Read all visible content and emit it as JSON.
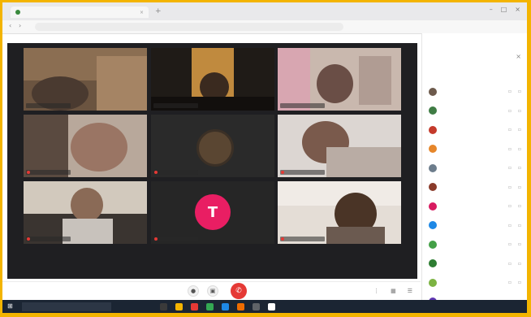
{
  "browser": {
    "tab_title": "",
    "url": "",
    "new_tab_glyph": "+",
    "close_glyph": "×",
    "window_controls": [
      "–",
      "□",
      "×"
    ],
    "back_glyph": "‹",
    "forward_glyph": "›"
  },
  "meeting": {
    "info": "",
    "end_call_glyph": "✆",
    "left_controls": [
      "●",
      "▣"
    ],
    "right_controls": [
      "⋮",
      "▦",
      "☰"
    ]
  },
  "participants_panel": {
    "header": "",
    "close_glyph": "×",
    "sub_left": "",
    "sub_right": "",
    "rows": [
      {
        "color": "#6d5a4c"
      },
      {
        "color": "#3f7c44"
      },
      {
        "color": "#c43a2b"
      },
      {
        "color": "#e6862a"
      },
      {
        "color": "#6d7d8c"
      },
      {
        "color": "#8a3b2a"
      },
      {
        "color": "#d81b60"
      },
      {
        "color": "#1e88e5"
      },
      {
        "color": "#43a047"
      },
      {
        "color": "#2e7d32"
      },
      {
        "color": "#7cb342"
      },
      {
        "color": "#5e35b1"
      }
    ]
  },
  "taskbar": {
    "start_glyph": "⊞",
    "search": "",
    "tray": "",
    "app_icon_colors": [
      "#3a3a3a",
      "#f4b400",
      "#e53935",
      "#34a853",
      "#1e88e5",
      "#ef6c00",
      "#5f6368",
      "#ffffff"
    ]
  },
  "colors": {
    "frame": "#f3b400",
    "stage": "#1f1f22",
    "hangup": "#e53935",
    "avatar_pink": "#e91e63"
  },
  "tiles": [
    {
      "id": "tile-1",
      "kind": "video"
    },
    {
      "id": "tile-2",
      "kind": "video"
    },
    {
      "id": "tile-3",
      "kind": "video"
    },
    {
      "id": "tile-4",
      "kind": "video"
    },
    {
      "id": "tile-5",
      "kind": "avatar"
    },
    {
      "id": "tile-6",
      "kind": "video"
    },
    {
      "id": "tile-7",
      "kind": "video"
    },
    {
      "id": "tile-8",
      "kind": "avatar"
    },
    {
      "id": "tile-9",
      "kind": "video"
    }
  ],
  "avatar_glyph_pink": "T"
}
